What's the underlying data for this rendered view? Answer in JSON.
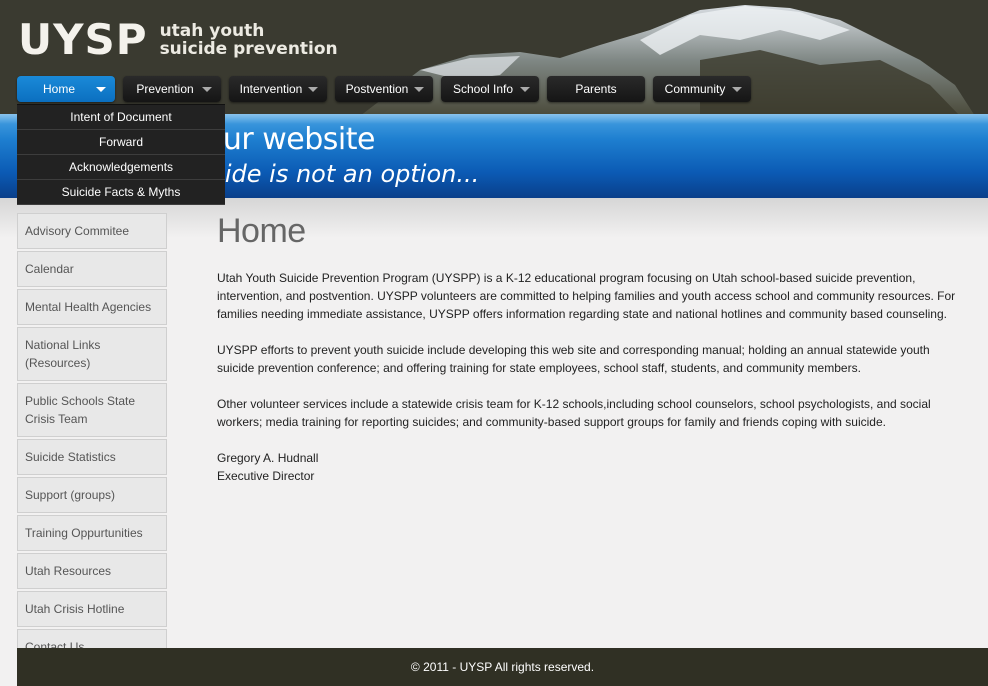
{
  "header": {
    "logo_mark": "UYSP",
    "logo_line1": "utah youth",
    "logo_line2": "suicide prevention"
  },
  "nav": {
    "items": [
      {
        "label": "Home",
        "has_dropdown": true,
        "active": true
      },
      {
        "label": "Prevention",
        "has_dropdown": true
      },
      {
        "label": "Intervention",
        "has_dropdown": true
      },
      {
        "label": "Postvention",
        "has_dropdown": true
      },
      {
        "label": "School Info",
        "has_dropdown": true
      },
      {
        "label": "Parents",
        "has_dropdown": false
      },
      {
        "label": "Community",
        "has_dropdown": true
      }
    ],
    "dropdown": [
      "Intent of Document",
      "Forward",
      "Acknowledgements",
      "Suicide Facts & Myths"
    ]
  },
  "banner": {
    "title": "our website",
    "subtitle": "icide is not an option..."
  },
  "sidebar": {
    "items": [
      "Advisory Commitee",
      "Calendar",
      "Mental Health Agencies",
      "National Links (Resources)",
      "Public Schools State Crisis Team",
      "Suicide Statistics",
      "Support (groups)",
      "Training Oppurtunities",
      "Utah Resources",
      "Utah Crisis Hotline",
      "Contact Us"
    ]
  },
  "main": {
    "title": "Home",
    "paragraphs": [
      "Utah Youth Suicide Prevention Program (UYSPP) is a K-12 educational program focusing on Utah school-based suicide prevention, intervention, and postvention. UYSPP volunteers are committed to helping families and youth access school and community resources. For families needing immediate assistance, UYSPP offers information regarding state and national hotlines and community based counseling.",
      "UYSPP efforts to prevent youth suicide include developing this web site and corresponding manual; holding an annual statewide youth suicide prevention conference; and offering training for state employees, school staff, students, and community members.",
      "Other volunteer services include a statewide crisis team for K-12 schools,including school counselors, school psychologists, and social workers; media training for reporting suicides; and community-based support groups for family and friends coping with suicide."
    ],
    "signature_name": "Gregory A. Hudnall",
    "signature_title": "Executive Director"
  },
  "footer": {
    "text": "© 2011 - UYSP All rights reserved."
  },
  "colors": {
    "header_bg": "#3a3a30",
    "nav_active": "#1a8ad8",
    "banner_blue": "#1e7fd0",
    "footer_bg": "#303024"
  }
}
